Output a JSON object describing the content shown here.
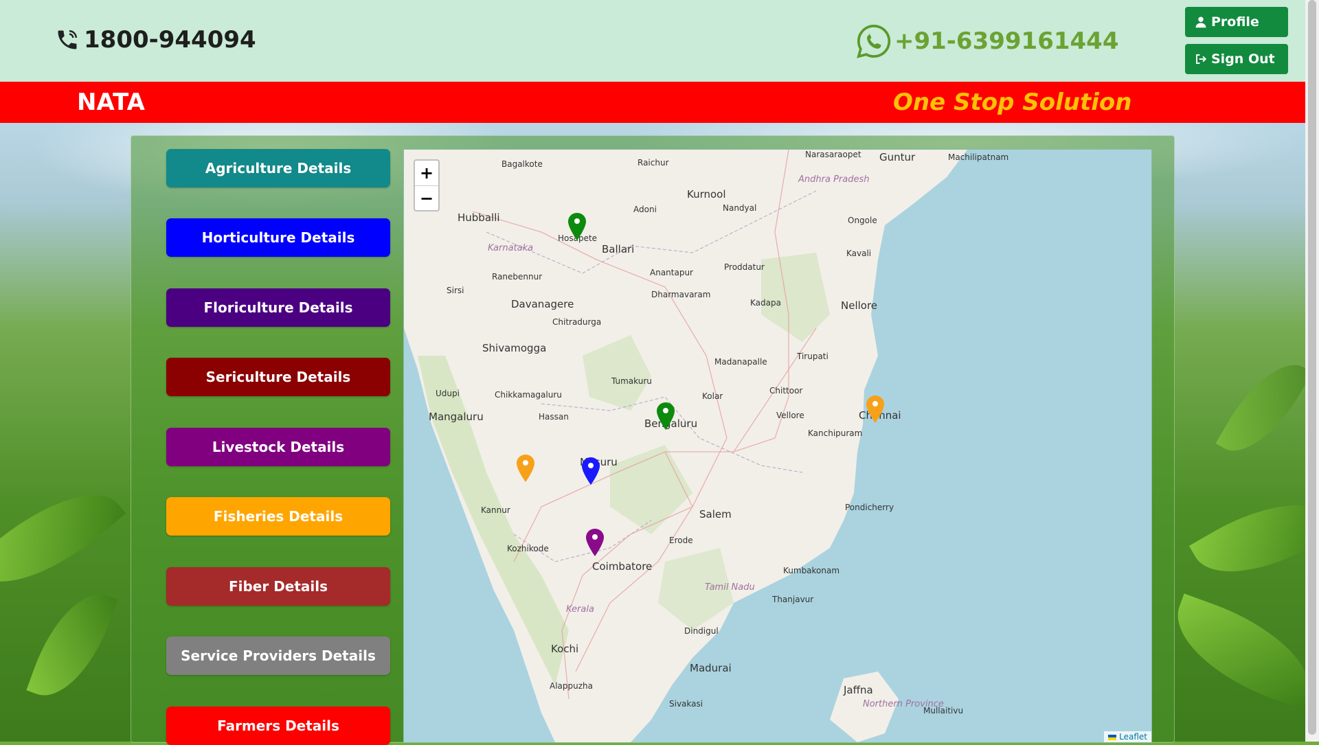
{
  "header": {
    "phone_number": "1800-944094",
    "whatsapp_number": "+91-6399161444",
    "profile_label": "Profile",
    "signout_label": "Sign Out",
    "brand_color": "#128b3e"
  },
  "banner": {
    "brand": "NATA",
    "tagline": "One Stop Solution"
  },
  "sidebar": {
    "items": [
      {
        "label": "Agriculture Details",
        "color": "#12898a"
      },
      {
        "label": "Horticulture Details",
        "color": "#0000ff"
      },
      {
        "label": "Floriculture Details",
        "color": "#4b0082"
      },
      {
        "label": "Sericulture Details",
        "color": "#8b0000"
      },
      {
        "label": "Livestock Details",
        "color": "#800080"
      },
      {
        "label": "Fisheries Details",
        "color": "#ffa500"
      },
      {
        "label": "Fiber Details",
        "color": "#a52a2a"
      },
      {
        "label": "Service Providers Details",
        "color": "#808080"
      },
      {
        "label": "Farmers Details",
        "color": "#ff0000"
      }
    ]
  },
  "map": {
    "zoom_in": "+",
    "zoom_out": "−",
    "attribution": "Leaflet",
    "places": [
      {
        "name": "Narasaraopet",
        "size": "small"
      },
      {
        "name": "Guntur",
        "size": "big"
      },
      {
        "name": "Machilipatnam",
        "size": "small"
      },
      {
        "name": "Bagalkote",
        "size": "small"
      },
      {
        "name": "Raichur",
        "size": "small"
      },
      {
        "name": "Andhra Pradesh",
        "size": "region"
      },
      {
        "name": "Kurnool",
        "size": "big"
      },
      {
        "name": "Adoni",
        "size": "small"
      },
      {
        "name": "Nandyal",
        "size": "small"
      },
      {
        "name": "Hubballi",
        "size": "big"
      },
      {
        "name": "Ongole",
        "size": "small"
      },
      {
        "name": "Hosapete",
        "size": "small"
      },
      {
        "name": "Ballari",
        "size": "big"
      },
      {
        "name": "Karnataka",
        "size": "region"
      },
      {
        "name": "Kavali",
        "size": "small"
      },
      {
        "name": "Ranebennur",
        "size": "small"
      },
      {
        "name": "Anantapur",
        "size": "small"
      },
      {
        "name": "Proddatur",
        "size": "small"
      },
      {
        "name": "Sirsi",
        "size": "small"
      },
      {
        "name": "Dharmavaram",
        "size": "small"
      },
      {
        "name": "Davanagere",
        "size": "big"
      },
      {
        "name": "Kadapa",
        "size": "small"
      },
      {
        "name": "Nellore",
        "size": "big"
      },
      {
        "name": "Chitradurga",
        "size": "small"
      },
      {
        "name": "Shivamogga",
        "size": "big"
      },
      {
        "name": "Madanapalle",
        "size": "small"
      },
      {
        "name": "Tirupati",
        "size": "small"
      },
      {
        "name": "Tumakuru",
        "size": "small"
      },
      {
        "name": "Udupi",
        "size": "small"
      },
      {
        "name": "Chikkamagaluru",
        "size": "small"
      },
      {
        "name": "Chittoor",
        "size": "small"
      },
      {
        "name": "Kolar",
        "size": "small"
      },
      {
        "name": "Mangaluru",
        "size": "big"
      },
      {
        "name": "Hassan",
        "size": "small"
      },
      {
        "name": "Vellore",
        "size": "small"
      },
      {
        "name": "Chennai",
        "size": "big"
      },
      {
        "name": "Bengaluru",
        "size": "big"
      },
      {
        "name": "Kanchipuram",
        "size": "small"
      },
      {
        "name": "Mysuru",
        "size": "big"
      },
      {
        "name": "Kannur",
        "size": "small"
      },
      {
        "name": "Salem",
        "size": "big"
      },
      {
        "name": "Pondicherry",
        "size": "small"
      },
      {
        "name": "Kozhikode",
        "size": "small"
      },
      {
        "name": "Erode",
        "size": "small"
      },
      {
        "name": "Coimbatore",
        "size": "big"
      },
      {
        "name": "Kumbakonam",
        "size": "small"
      },
      {
        "name": "Tamil Nadu",
        "size": "region"
      },
      {
        "name": "Kerala",
        "size": "region"
      },
      {
        "name": "Thanjavur",
        "size": "small"
      },
      {
        "name": "Dindigul",
        "size": "small"
      },
      {
        "name": "Kochi",
        "size": "big"
      },
      {
        "name": "Madurai",
        "size": "big"
      },
      {
        "name": "Alappuzha",
        "size": "small"
      },
      {
        "name": "Jaffna",
        "size": "big"
      },
      {
        "name": "Sivakasi",
        "size": "small"
      },
      {
        "name": "Northern Province",
        "size": "region"
      },
      {
        "name": "Mullaitivu",
        "size": "small"
      }
    ],
    "markers": [
      {
        "name": "marker-agriculture-hosapete",
        "color": "#0e8a0e"
      },
      {
        "name": "marker-agriculture-bengaluru",
        "color": "#0e8a0e"
      },
      {
        "name": "marker-fisheries-chennai",
        "color": "#f7a11a"
      },
      {
        "name": "marker-fisheries-kodagu",
        "color": "#f7a11a"
      },
      {
        "name": "marker-horticulture-mysuru",
        "color": "#1a1aff"
      },
      {
        "name": "marker-livestock-coimbatore",
        "color": "#8a0a8a"
      }
    ]
  }
}
